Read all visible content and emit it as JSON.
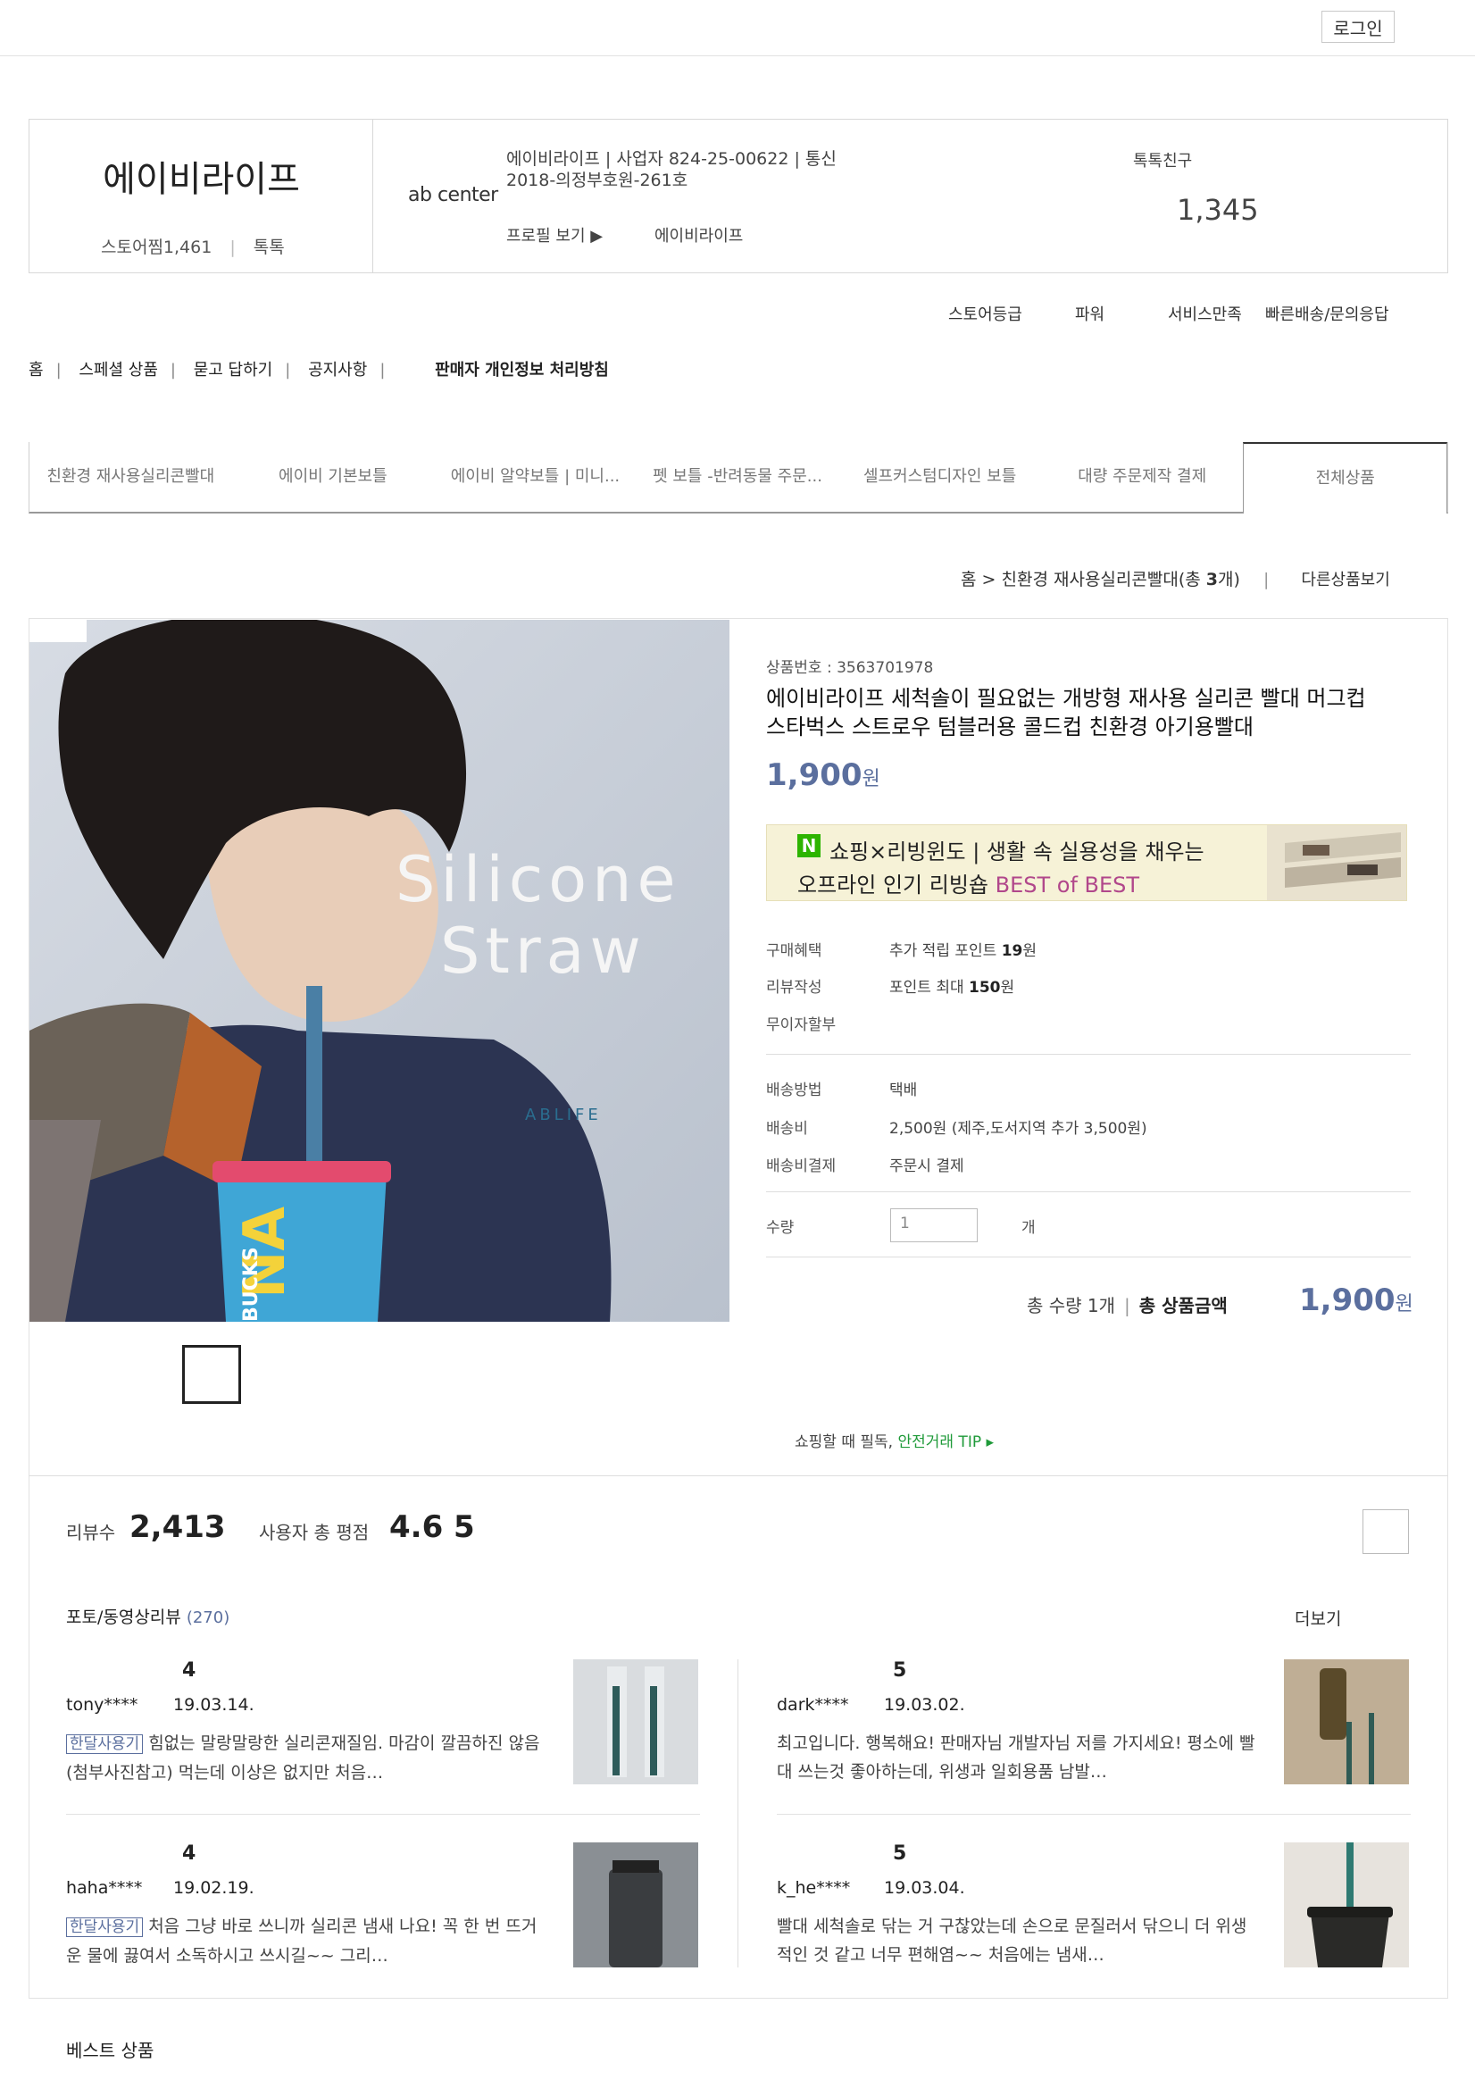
{
  "header": {
    "login": "로그인"
  },
  "store": {
    "name": "에이비라이프",
    "score_label": "스토어찜",
    "score_value": "1,461",
    "talk": "톡톡",
    "logo_text": "ab center",
    "info_line1": "에이비라이프  |  사업자 824-25-00622 | 통신",
    "info_line2": "2018-의정부호원-261호",
    "profile_link": "프로필 보기 ▶",
    "store_link": "에이비라이프",
    "friend_label": "톡톡친구",
    "friend_count": "1,345"
  },
  "grades": {
    "grade_label": "스토어등급",
    "grade_value": "파워",
    "service_label": "서비스만족",
    "service_value": "빠른배송/문의응답"
  },
  "nav": {
    "items": [
      "홈",
      "스페셜 상품",
      "묻고 답하기",
      "공지사항"
    ],
    "privacy": "판매자 개인정보 처리방침"
  },
  "categories": [
    "친환경 재사용실리콘빨대",
    "에이비 기본보틀",
    "에이비 알약보틀 | 미니...",
    "펫 보틀 -반려동물 주문...",
    "셀프커스텀디자인 보틀",
    "대량 주문제작 결제",
    "전체상품"
  ],
  "breadcrumb": {
    "home": "홈",
    "category": "친환경 재사용실리콘빨대(총 ",
    "count": "3",
    "suffix": "개)",
    "other": "다른상품보기"
  },
  "product": {
    "image_text_line1": "Silicone",
    "image_text_line2": "Straw",
    "image_brand": "ABLIFE",
    "cup_text": "BUCKS",
    "cup_text2": "NA",
    "number_label": "상품번호 : ",
    "number": "3563701978",
    "title": "에이비라이프 세척솔이 필요없는 개방형 재사용 실리콘 빨대 머그컵 스타벅스 스트로우 텀블러용 콜드컵 친환경 아기용빨대",
    "price": "1,900",
    "price_unit": "원",
    "banner_badge": "N",
    "banner_line1": "쇼핑×리빙윈도 | 생활 속 실용성을 채우는",
    "banner_line2_a": "오프라인 인기 리빙숍 ",
    "banner_line2_b": "BEST of BEST",
    "benefit_label": "구매혜택",
    "benefit_value_a": "추가 적립 포인트 ",
    "benefit_value_b": "19",
    "benefit_value_c": "원",
    "review_label": "리뷰작성",
    "review_value_a": "포인트 최대 ",
    "review_value_b": "150",
    "review_value_c": "원",
    "installment_label": "무이자할부",
    "ship_method_label": "배송방법",
    "ship_method_value": "택배",
    "ship_fee_label": "배송비",
    "ship_fee_value": "2,500원 (제주,도서지역 추가 3,500원)",
    "ship_pay_label": "배송비결제",
    "ship_pay_value": "주문시 결제",
    "qty_label": "수량",
    "qty_value": "1",
    "qty_unit": "개",
    "total_qty": "총 수량 1개",
    "total_label": "총 상품금액",
    "total_price": "1,900",
    "safety_a": "쇼핑할 때 필독, ",
    "safety_b": "안전거래 TIP ▸"
  },
  "reviews": {
    "count_label": "리뷰수",
    "count": "2,413",
    "avg_label": "사용자 총 평점",
    "avg": "4.6",
    "max": "5",
    "photo_title": "포토/동영상리뷰",
    "photo_count": "(270)",
    "more": "더보기",
    "badge": "한달사용기",
    "items": [
      {
        "stars": "4",
        "user": "tony****",
        "date": "19.03.14.",
        "badge": true,
        "text": "힘없는 말랑말랑한 실리콘재질임. 마감이 깔끔하진 않음(첨부사진참고) 먹는데 이상은 없지만 처음…"
      },
      {
        "stars": "5",
        "user": "dark****",
        "date": "19.03.02.",
        "badge": false,
        "text": "최고입니다. 행복해요! 판매자님 개발자님 저를 가지세요! 평소에 빨대 쓰는것 좋아하는데, 위생과 일회용품 남발…"
      },
      {
        "stars": "4",
        "user": "haha****",
        "date": "19.02.19.",
        "badge": true,
        "text": "처음 그냥 바로 쓰니까 실리콘 냄새 나요! 꼭 한 번 뜨거운 물에 끓여서 소독하시고 쓰시길~~ 그리…"
      },
      {
        "stars": "5",
        "user": "k_he****",
        "date": "19.03.04.",
        "badge": false,
        "text": "빨대 세척솔로 닦는 거 구찮았는데 손으로 문질러서 닦으니 더 위생적인 것 같고 너무 편해염~~ 처음에는 냄새…"
      }
    ]
  },
  "best": {
    "title": "베스트 상품"
  }
}
